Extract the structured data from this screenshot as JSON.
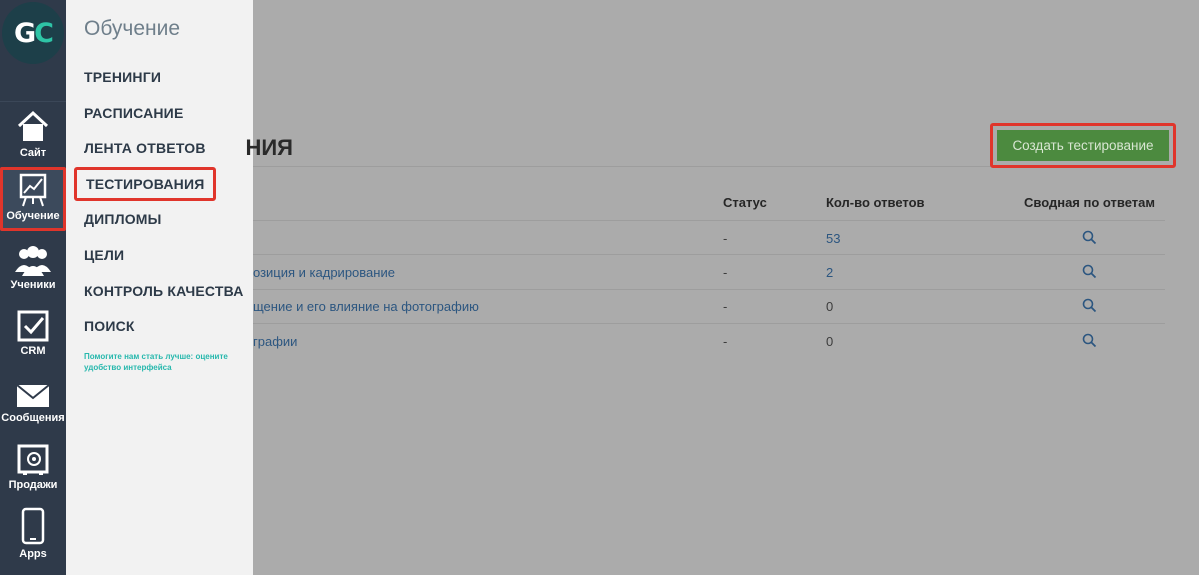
{
  "rail": {
    "items": [
      {
        "label": "Сайт",
        "icon": "home-icon"
      },
      {
        "label": "Обучение",
        "icon": "training-board-icon"
      },
      {
        "label": "Ученики",
        "icon": "users-icon"
      },
      {
        "label": "CRM",
        "icon": "checkbox-icon"
      },
      {
        "label": "Сообщения",
        "icon": "envelope-icon"
      },
      {
        "label": "Продажи",
        "icon": "safe-icon"
      },
      {
        "label": "Apps",
        "icon": "phone-icon"
      }
    ]
  },
  "panel": {
    "title": "Обучение",
    "items": [
      "ТРЕНИНГИ",
      "РАСПИСАНИЕ",
      "ЛЕНТА ОТВЕТОВ",
      "ТЕСТИРОВАНИЯ",
      "ДИПЛОМЫ",
      "ЦЕЛИ",
      "КОНТРОЛЬ КАЧЕСТВА",
      "ПОИСК"
    ],
    "feedback": "Помогите нам стать лучше: оцените удобство интерфейса"
  },
  "main": {
    "title_fragment": "НИЯ",
    "create_button": "Создать тестирование",
    "columns": [
      "Статус",
      "Кол-во ответов",
      "Сводная по ответам"
    ],
    "rows": [
      {
        "name": "",
        "status": "-",
        "answers": "53"
      },
      {
        "name": "озиция и кадрирование",
        "status": "-",
        "answers": "2"
      },
      {
        "name": "щение и его влияние на фотографию",
        "status": "-",
        "answers": "0"
      },
      {
        "name": "графии",
        "status": "-",
        "answers": "0"
      }
    ]
  },
  "colors": {
    "rail": "#2f3a4a",
    "highlight": "#e0352b",
    "create_button": "#4c8a3f",
    "link": "#2c5680"
  }
}
